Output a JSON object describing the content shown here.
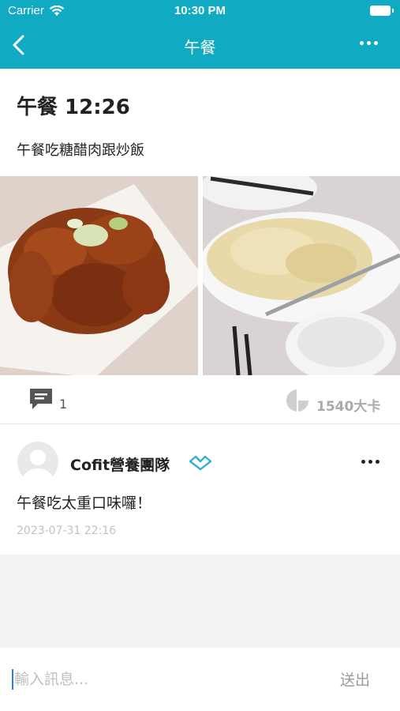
{
  "status_bar": {
    "carrier": "Carrier",
    "time": "10:30 PM"
  },
  "nav": {
    "title": "午餐"
  },
  "post": {
    "title": "午餐 12:26",
    "description": "午餐吃糖醋肉跟炒飯",
    "photos": [
      "sweet-sour-pork-photo",
      "fried-rice-photo"
    ],
    "comment_count": "1",
    "calories": "1540大卡"
  },
  "comment": {
    "author": "Cofit營養團隊",
    "text": "午餐吃太重口味囉！",
    "timestamp": "2023-07-31 22:16"
  },
  "input": {
    "placeholder": "輸入訊息...",
    "send_label": "送出"
  },
  "colors": {
    "header": "#11aac3",
    "accent": "#3ab0d1",
    "muted": "#aaaaaa"
  }
}
